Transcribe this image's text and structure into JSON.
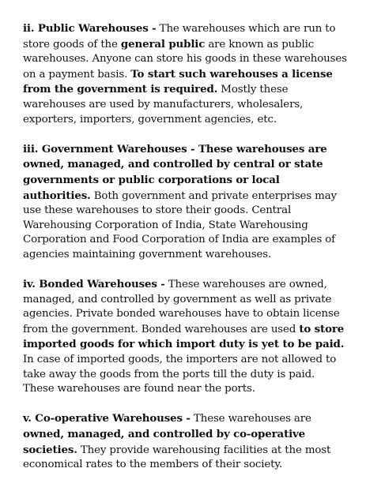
{
  "sections": [
    {
      "segments": [
        {
          "text": "ii. Public Warehouses -",
          "bold": true
        },
        {
          "text": " The warehouses which are run to store goods of the ",
          "bold": false
        },
        {
          "text": "general public",
          "bold": true
        },
        {
          "text": " are known as public warehouses. Anyone can store his goods in these warehouses on a payment basis. ",
          "bold": false
        },
        {
          "text": "To start such warehouses a license from the government is required.",
          "bold": true
        },
        {
          "text": " Mostly these warehouses are used by manufacturers, wholesalers, exporters, importers, government agencies, etc.",
          "bold": false
        }
      ]
    },
    {
      "segments": [
        {
          "text": "iii. Government Warehouses - These warehouses are owned, managed, and controlled by central or state governments or public corporations or local authorities.",
          "bold": true
        },
        {
          "text": " Both government and private enterprises may use these warehouses to store their goods. Central Warehousing Corporation of India, State Warehousing Corporation and Food Corporation of India are examples of agencies maintaining government warehouses.",
          "bold": false
        }
      ]
    },
    {
      "segments": [
        {
          "text": "iv. Bonded Warehouses -",
          "bold": true
        },
        {
          "text": " These warehouses are owned, managed, and controlled by government as well as private agencies. Private bonded warehouses have to obtain license from the government. Bonded warehouses are used ",
          "bold": false
        },
        {
          "text": "to store imported goods for which import duty is yet to be paid.",
          "bold": true
        },
        {
          "text": " In case of imported goods, the importers are not allowed to take away the goods from the ports till the duty is paid. These warehouses are found near the ports.",
          "bold": false
        }
      ]
    },
    {
      "segments": [
        {
          "text": "v. Co-operative Warehouses -",
          "bold": true
        },
        {
          "text": " These warehouses are ",
          "bold": false
        },
        {
          "text": "owned, managed, and controlled by co-operative societies.",
          "bold": true
        },
        {
          "text": " They provide warehousing facilities at the most economical rates to the members of their society.",
          "bold": false
        }
      ]
    }
  ]
}
